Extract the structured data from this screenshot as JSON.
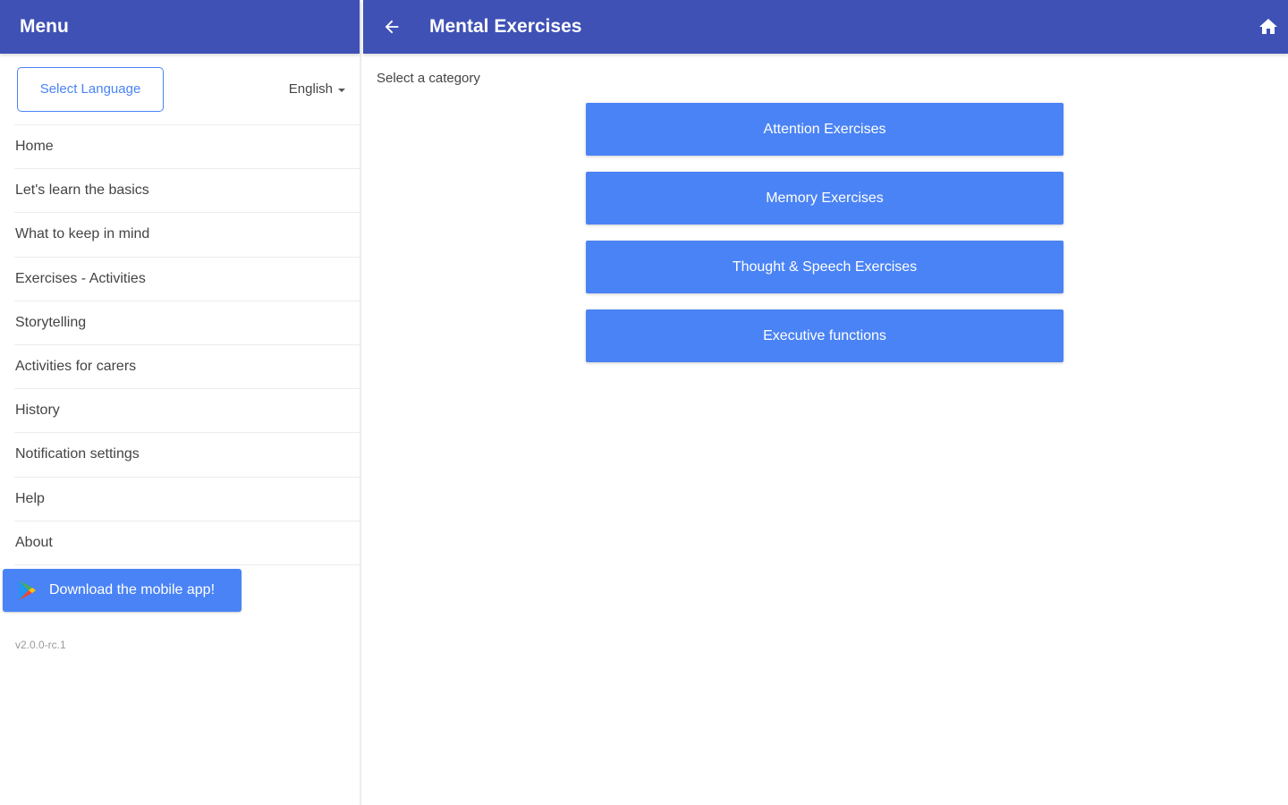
{
  "sidebar": {
    "title": "Menu",
    "language_button": "Select Language",
    "language_value": "English",
    "items": [
      {
        "label": "Home"
      },
      {
        "label": "Let's learn the basics"
      },
      {
        "label": "What to keep in mind"
      },
      {
        "label": "Exercises - Activities"
      },
      {
        "label": "Storytelling"
      },
      {
        "label": "Activities for carers"
      },
      {
        "label": "History"
      },
      {
        "label": "Notification settings"
      },
      {
        "label": "Help"
      },
      {
        "label": "About"
      }
    ],
    "download_label": "Download the mobile app!",
    "version": "v2.0.0-rc.1"
  },
  "header": {
    "title": "Mental Exercises"
  },
  "main": {
    "subtitle": "Select a category",
    "categories": [
      {
        "label": "Attention Exercises"
      },
      {
        "label": "Memory Exercises"
      },
      {
        "label": "Thought & Speech Exercises"
      },
      {
        "label": "Executive functions"
      }
    ]
  },
  "colors": {
    "primary": "#3f51b5",
    "accent": "#4a83f5"
  }
}
